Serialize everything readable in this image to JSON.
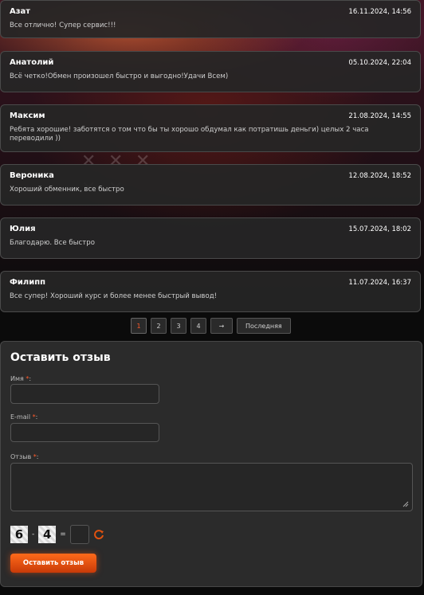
{
  "reviews": [
    {
      "author": "Азат",
      "date": "16.11.2024, 14:56",
      "text": "Все отлично! Супер сервис!!!"
    },
    {
      "author": "Анатолий",
      "date": "05.10.2024, 22:04",
      "text": "Всё четко!Обмен произошел быстро и выгодно!Удачи Всем)"
    },
    {
      "author": "Максим",
      "date": "21.08.2024, 14:55",
      "text": "Ребята хорошие! заботятся о том что бы ты хорошо обдумал как потратишь деньги) целых 2 часа переводили ))"
    },
    {
      "author": "Вероника",
      "date": "12.08.2024, 18:52",
      "text": "Хороший обменник, все быстро"
    },
    {
      "author": "Юлия",
      "date": "15.07.2024, 18:02",
      "text": "Благодарю. Все быстро"
    },
    {
      "author": "Филипп",
      "date": "11.07.2024, 16:37",
      "text": "Все супер! Хороший курс и более менее быстрый вывод!"
    }
  ],
  "pagination": {
    "pages": [
      "1",
      "2",
      "3",
      "4"
    ],
    "current": "1",
    "next": "→",
    "last": "Последняя"
  },
  "form": {
    "title": "Оставить отзыв",
    "name_label": "Имя",
    "email_label": "E-mail",
    "review_label": "Отзыв",
    "required_mark": "*",
    "colon": ":",
    "name_value": "",
    "email_value": "",
    "review_value": "",
    "captcha": {
      "a": "6",
      "op": "-",
      "b": "4",
      "eq": "=",
      "answer": ""
    },
    "submit": "Оставить отзыв"
  },
  "colors": {
    "accent": "#ff5a2a",
    "card_bg": "#262626",
    "button": "#e2520f"
  },
  "icons": {
    "refresh": "refresh-icon",
    "next": "arrow-right-icon",
    "resize": "resize-handle-icon"
  }
}
